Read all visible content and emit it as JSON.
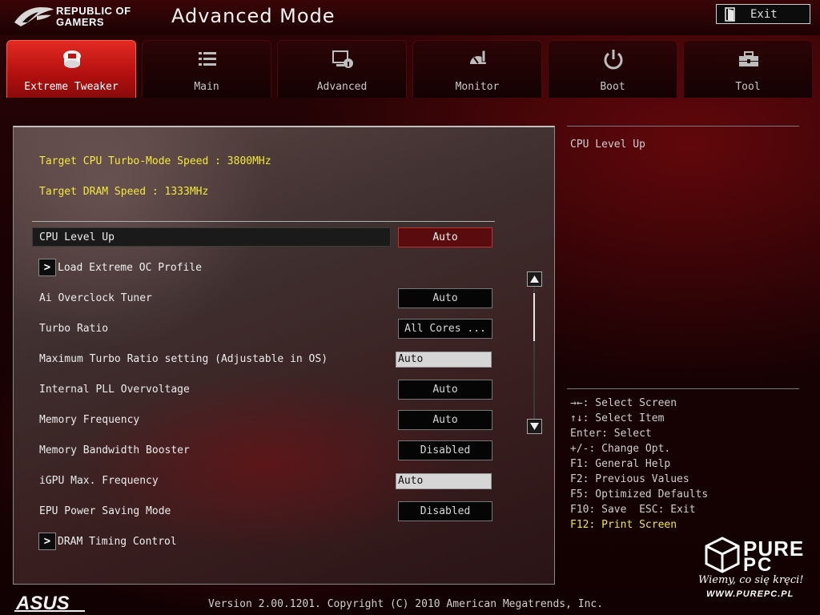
{
  "header": {
    "brand_line1": "REPUBLIC OF",
    "brand_line2": "GAMERS",
    "title": "Advanced Mode",
    "exit_label": "Exit"
  },
  "tabs": [
    {
      "label": "Extreme Tweaker",
      "icon": "extreme-tweaker-icon",
      "active": true
    },
    {
      "label": "Main",
      "icon": "list-icon",
      "active": false
    },
    {
      "label": "Advanced",
      "icon": "advanced-settings-icon",
      "active": false
    },
    {
      "label": "Monitor",
      "icon": "monitor-gauge-icon",
      "active": false
    },
    {
      "label": "Boot",
      "icon": "power-icon",
      "active": false
    },
    {
      "label": "Tool",
      "icon": "toolbox-icon",
      "active": false
    }
  ],
  "info": {
    "cpu_speed": "Target CPU Turbo-Mode Speed : 3800MHz",
    "dram_speed": "Target DRAM Speed : 1333MHz"
  },
  "settings": {
    "cpu_level_up": {
      "label": "CPU Level Up",
      "value": "Auto"
    },
    "load_oc_profile": {
      "label": "Load Extreme OC Profile"
    },
    "ai_overclock": {
      "label": "Ai Overclock Tuner",
      "value": "Auto"
    },
    "turbo_ratio": {
      "label": "Turbo Ratio",
      "value": "All Cores ..."
    },
    "max_turbo_ratio": {
      "label": "Maximum Turbo Ratio setting (Adjustable in OS)",
      "value": "Auto"
    },
    "pll_overvoltage": {
      "label": "Internal PLL Overvoltage",
      "value": "Auto"
    },
    "memory_frequency": {
      "label": "Memory Frequency",
      "value": "Auto"
    },
    "memory_bandwidth": {
      "label": "Memory Bandwidth Booster",
      "value": "Disabled"
    },
    "igpu_max_freq": {
      "label": "iGPU Max. Frequency",
      "value": "Auto"
    },
    "epu_power": {
      "label": "EPU Power Saving Mode",
      "value": "Disabled"
    },
    "dram_timing": {
      "label": "DRAM Timing Control"
    },
    "arrow_glyph": ">"
  },
  "help": {
    "title": "CPU Level Up",
    "keys": [
      "→←: Select Screen",
      "↑↓: Select Item",
      "Enter: Select",
      "+/-: Change Opt.",
      "F1: General Help",
      "F2: Previous Values",
      "F5: Optimized Defaults",
      "F10: Save  ESC: Exit",
      "F12: Print Screen"
    ],
    "highlight_color": "#f2e93a"
  },
  "footer": {
    "brand": "ASUS",
    "version": "Version 2.00.1201. Copyright (C) 2010 American Megatrends, Inc."
  },
  "watermark": {
    "line1": "PURE",
    "line2": "PC",
    "slogan": "Wiemy, co się kręci!",
    "url": "WWW.PUREPC.PL"
  },
  "colors": {
    "accent_red": "#d41e1a",
    "info_yellow": "#f2e93a",
    "background": "#1a0204"
  }
}
